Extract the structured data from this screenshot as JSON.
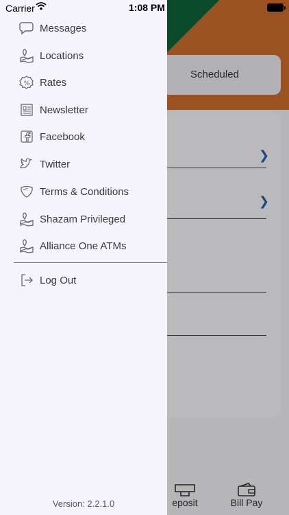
{
  "status_bar": {
    "carrier": "Carrier",
    "time": "1:08 PM"
  },
  "menu": {
    "items": [
      {
        "label": "Messages",
        "icon": "chat-bubble-icon"
      },
      {
        "label": "Locations",
        "icon": "map-pin-icon"
      },
      {
        "label": "Rates",
        "icon": "percent-badge-icon"
      },
      {
        "label": "Newsletter",
        "icon": "newspaper-icon"
      },
      {
        "label": "Facebook",
        "icon": "facebook-icon"
      },
      {
        "label": "Twitter",
        "icon": "twitter-bird-icon"
      },
      {
        "label": "Terms & Conditions",
        "icon": "shield-icon"
      },
      {
        "label": "Shazam Privileged",
        "icon": "map-pin-icon"
      },
      {
        "label": "Alliance One ATMs",
        "icon": "map-pin-icon"
      }
    ],
    "logout_label": "Log Out",
    "version": "Version: 2.2.1.0"
  },
  "background": {
    "card_label": "Scheduled",
    "tabs": [
      {
        "label": "eposit",
        "icon": "deposit-check-icon"
      },
      {
        "label": "Bill Pay",
        "icon": "wallet-icon"
      }
    ]
  }
}
